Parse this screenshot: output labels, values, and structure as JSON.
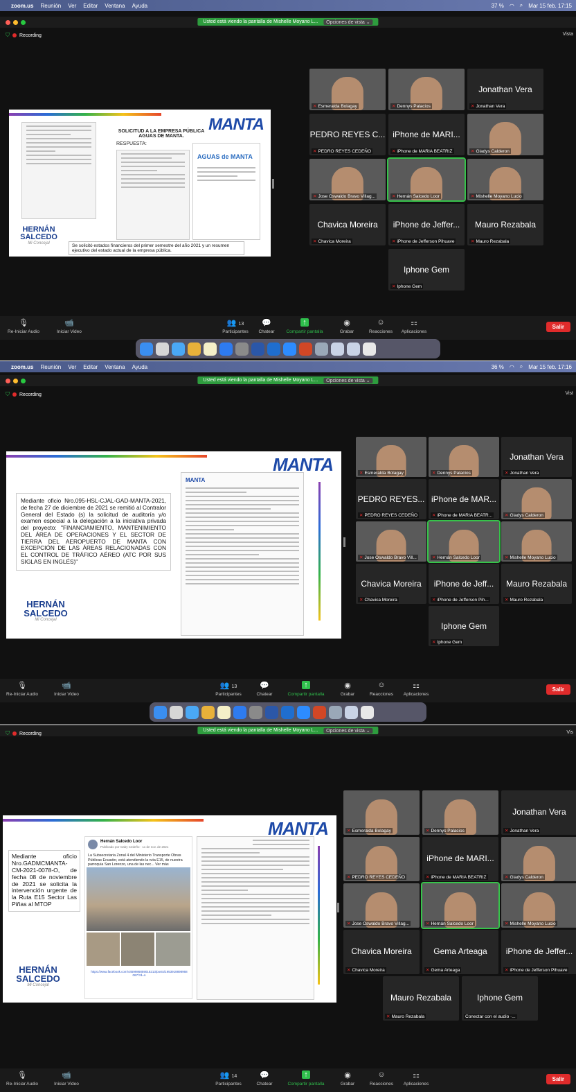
{
  "menubar": {
    "app": "zoom.us",
    "items": [
      "Reunión",
      "Ver",
      "Editar",
      "Ventana",
      "Ayuda"
    ],
    "battery_1": "37 %",
    "battery_2": "36 %",
    "datetime_1": "Mar 15 feb.  17:15",
    "datetime_2": "Mar 15 feb.  17:16"
  },
  "banner": {
    "text": "Usted está viendo la pantalla de Mishelle Moyano L...",
    "options": "Opciones de vista ⌄"
  },
  "recording": "Recording",
  "vista_1": "Vista",
  "vista_2": "Vist",
  "vista_3": "Vis",
  "slide1": {
    "logo": "MANTA",
    "title": "SOLICITUD A LA EMPRESA PÚBLICA AGUAS DE MANTA.",
    "respuesta": "RESPUESTA:",
    "aguas": "AGUAS de MANTA",
    "caption": "Se solicitó estados financieros del primer semestre del año 2021 y un resumen ejecutivo del estado actual de la empresa pública.",
    "candidate": "HERNÁN SALCEDO",
    "sub": "Mi Concejal"
  },
  "slide2": {
    "logo": "MANTA",
    "text": "Mediante oficio Nro.095-HSL-CJAL-GAD-MANTA-2021, de fecha 27 de diciembre de 2021 se remitió al Contralor General del Estado (s) la solicitud de auditoría y/o examen especial a la delegación a la iniciativa privada del proyecto: \"FINANCIAMIENTO, MANTENIMIENTO DEL ÁREA DE OPERACIONES Y EL SECTOR DE TIERRA DEL AEROPUERTO DE MANTA CON EXCEPCIÓN DE LAS ÁREAS RELACIONADAS CON EL CONTROL DE TRÁFICO AÉREO (ATC POR SUS SIGLAS EN INGLÉS)\"",
    "candidate": "HERNÁN SALCEDO",
    "sub": "Mi Concejal"
  },
  "slide3": {
    "logo": "MANTA",
    "text": "Mediante oficio Nro.GADMCMANTA-CM-2021-0078-O, de fecha 08 de noviembre de 2021 se solicita la intervención urgente de la Ruta E15 Sector Las Piñas al MTOP",
    "post_author": "Hernán Salcedo Loor",
    "post_meta": "Publicado por Gaby Cedeño · 11 de nov. de 2021",
    "post_text": "La Subsecretaria Zonal 4 del Ministerio Transporte Obras Públicas Ecuador, está atendiendo la ruta E15, de nuestra parroquia San Lorenzo, una de las nec... Ver más",
    "post_link": "https://www.facebook.com/4459986859015213/posts/1953918898968067/?d=n",
    "candidate": "HERNÁN SALCEDO",
    "sub": "Mi Concejal"
  },
  "grid1": [
    {
      "name": "Esmeralda Bolagay",
      "big": "",
      "photo": true
    },
    {
      "name": "Dennys Palacios",
      "big": "",
      "photo": true
    },
    {
      "name": "Jonathan Vera",
      "big": "Jonathan Vera",
      "photo": false
    },
    {
      "name": "PEDRO REYES CEDEÑO",
      "big": "PEDRO REYES C...",
      "photo": false
    },
    {
      "name": "iPhone de MARIA BEATRIZ",
      "big": "iPhone de MARI...",
      "photo": false
    },
    {
      "name": "Gladys Calderon",
      "big": "",
      "photo": true
    },
    {
      "name": "Jose Oswaldo Bravo Villag...",
      "big": "",
      "photo": true
    },
    {
      "name": "Hernán Salcedo Loor",
      "big": "",
      "photo": true,
      "active": true
    },
    {
      "name": "Mishelle Moyano Lucio",
      "big": "",
      "photo": true
    },
    {
      "name": "Chavica Moreira",
      "big": "Chavica Moreira",
      "photo": false
    },
    {
      "name": "iPhone de Jefferson Pihuave",
      "big": "iPhone de Jeffer...",
      "photo": false
    },
    {
      "name": "Mauro Rezabala",
      "big": "Mauro Rezabala",
      "photo": false
    },
    {
      "name": "Iphone Gem",
      "big": "Iphone Gem",
      "photo": false
    }
  ],
  "grid2": [
    {
      "name": "Esmeralda Bolagay",
      "big": "",
      "photo": true
    },
    {
      "name": "Dennys Palacios",
      "big": "",
      "photo": true
    },
    {
      "name": "Jonathan Vera",
      "big": "Jonathan Vera",
      "photo": false
    },
    {
      "name": "PEDRO REYES CEDEÑO",
      "big": "PEDRO REYES...",
      "photo": false
    },
    {
      "name": "iPhone de MARIA BEATR...",
      "big": "iPhone de MAR...",
      "photo": false
    },
    {
      "name": "Gladys Calderon",
      "big": "",
      "photo": true
    },
    {
      "name": "Jose Oswaldo Bravo Vill...",
      "big": "",
      "photo": true
    },
    {
      "name": "Hernán Salcedo Loor",
      "big": "",
      "photo": true,
      "active": true
    },
    {
      "name": "Mishelle Moyano Lucio",
      "big": "",
      "photo": true
    },
    {
      "name": "Chavica Moreira",
      "big": "Chavica Moreira",
      "photo": false
    },
    {
      "name": "iPhone de Jefferson Pih...",
      "big": "iPhone de Jeff...",
      "photo": false
    },
    {
      "name": "Mauro Rezabala",
      "big": "Mauro Rezabala",
      "photo": false
    },
    {
      "name": "Iphone Gem",
      "big": "Iphone Gem",
      "photo": false
    }
  ],
  "grid3": [
    {
      "name": "Esmeralda Bolagay",
      "big": "",
      "photo": true
    },
    {
      "name": "Dennys Palacios",
      "big": "",
      "photo": true
    },
    {
      "name": "Jonathan Vera",
      "big": "Jonathan Vera",
      "photo": false
    },
    {
      "name": "PEDRO REYES CEDEÑO",
      "big": "",
      "photo": true
    },
    {
      "name": "iPhone de MARIA BEATRIZ",
      "big": "iPhone de MARI...",
      "photo": false
    },
    {
      "name": "Gladys Calderon",
      "big": "",
      "photo": true
    },
    {
      "name": "Jose Oswaldo Bravo Villag...",
      "big": "",
      "photo": true
    },
    {
      "name": "Hernán Salcedo Loor",
      "big": "",
      "photo": true,
      "active": true
    },
    {
      "name": "Mishelle Moyano Lucio",
      "big": "",
      "photo": true
    },
    {
      "name": "Chavica Moreira",
      "big": "Chavica Moreira",
      "photo": false
    },
    {
      "name": "Gema Arteaga",
      "big": "Gema Arteaga",
      "photo": false
    },
    {
      "name": "iPhone de Jefferson Pihuave",
      "big": "iPhone de Jeffer...",
      "photo": false
    },
    {
      "name": "Mauro Rezabala",
      "big": "Mauro Rezabala",
      "photo": false
    },
    {
      "name": "Conectar con el audio ·...",
      "big": "Iphone Gem",
      "photo": false,
      "nomic": true
    }
  ],
  "toolbar": {
    "audio": "Re-Iniciar Audio",
    "video": "Iniciar Video",
    "participants": "Participantes",
    "count_1": "13",
    "count_3": "14",
    "chat": "Chatear",
    "share": "Compartir pantalla",
    "record": "Grabar",
    "reactions": "Reacciones",
    "apps": "Aplicaciones",
    "leave": "Salir"
  },
  "colors": {
    "green": "#2e9c3e",
    "red": "#e02b2b",
    "manta_blue": "#1e4aa8",
    "candidate": "#1b3f8f"
  }
}
